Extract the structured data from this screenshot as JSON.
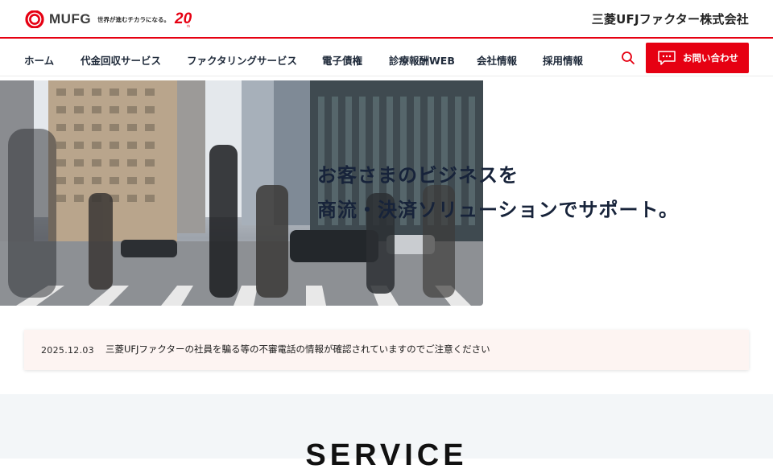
{
  "header": {
    "logo_text": "MUFG",
    "tagline": "世界が進むチカラになる。",
    "anniversary_number": "20",
    "anniversary_sub": "th",
    "company_name": "三菱UFJファクター株式会社",
    "brand_color": "#e60012"
  },
  "nav": {
    "items": [
      {
        "label": "ホーム"
      },
      {
        "label": "代金回収サービス"
      },
      {
        "label": "ファクタリングサービス"
      },
      {
        "label": "電子債権"
      },
      {
        "label": "診療報酬WEB"
      },
      {
        "label": "会社情報"
      },
      {
        "label": "採用情報"
      }
    ],
    "search_icon": "search-icon",
    "contact_label": "お問い合わせ",
    "contact_icon": "chat-bubble-icon"
  },
  "hero": {
    "headline_line1": "お客さまのビジネスを",
    "headline_line2": "商流・決済ソリューションでサポート。"
  },
  "notice": {
    "date": "2025.12.03",
    "text": "三菱UFJファクターの社員を騙る等の不審電話の情報が確認されていますのでご注意ください"
  },
  "service": {
    "title": "SERVICE"
  }
}
